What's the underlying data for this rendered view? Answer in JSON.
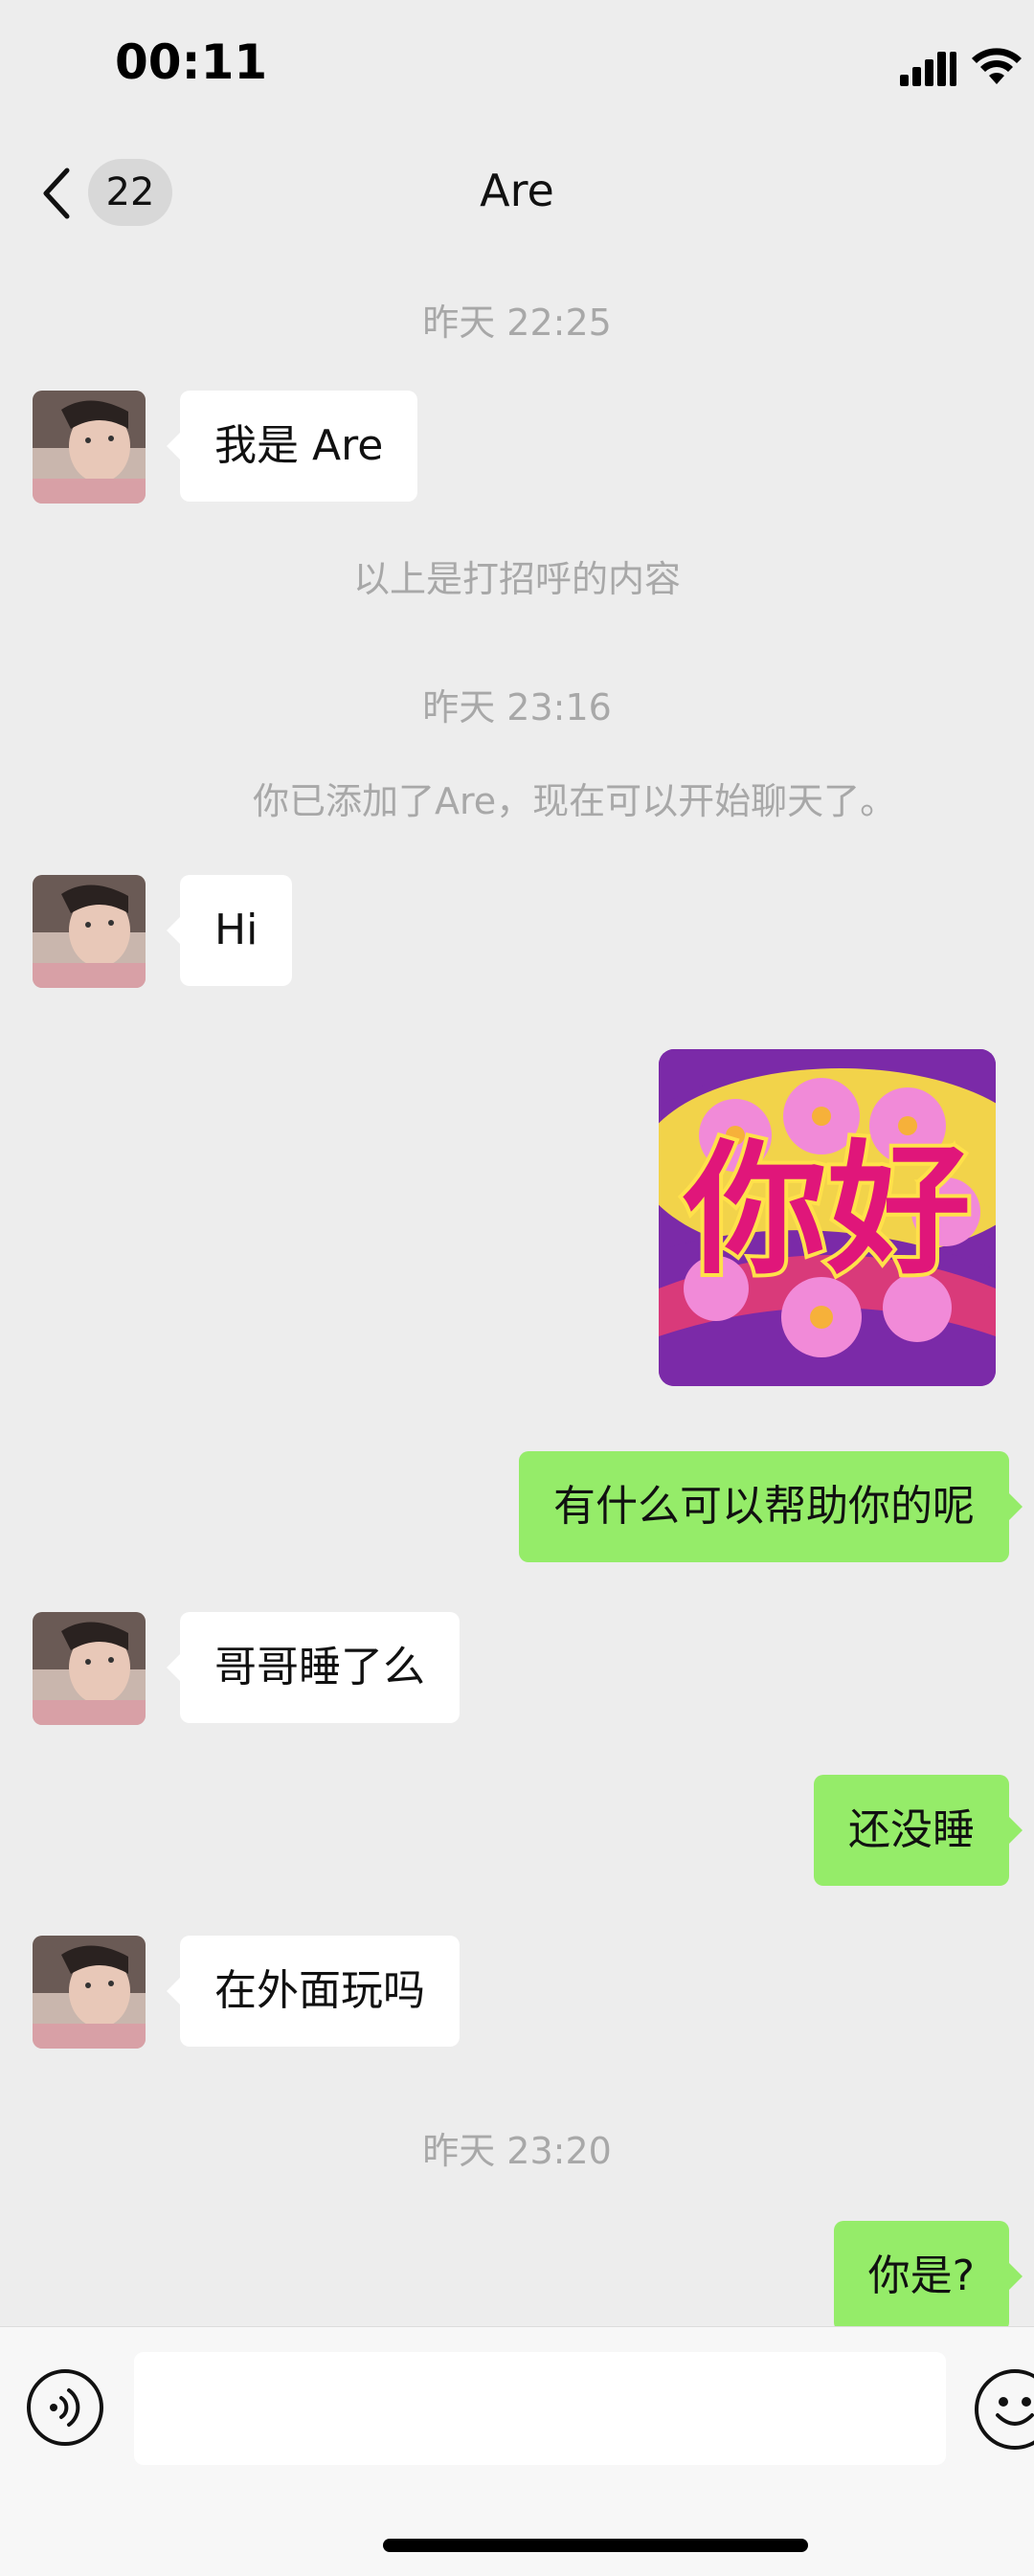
{
  "status_bar": {
    "time": "00:11"
  },
  "header": {
    "unread_count": "22",
    "title": "Are"
  },
  "messages": {
    "ts1": "昨天 22:25",
    "m1": "我是 Are",
    "sys1": "以上是打招呼的内容",
    "ts2": "昨天 23:16",
    "sys2": "你已添加了Are，现在可以开始聊天了。",
    "m2": "Hi",
    "sticker_text": "你好",
    "m3": "有什么可以帮助你的呢",
    "m4": "哥哥睡了么",
    "m5": "还没睡",
    "m6": "在外面玩吗",
    "ts3": "昨天 23:20",
    "m7": "你是?"
  },
  "input_bar": {
    "value": "",
    "placeholder": ""
  },
  "colors": {
    "background": "#ededed",
    "outgoing_bubble": "#95ec69",
    "incoming_bubble": "#ffffff",
    "timestamp_text": "#a8a8a8"
  },
  "icons": [
    "back-icon",
    "signal-icon",
    "wifi-icon",
    "voice-icon",
    "emoji-icon"
  ]
}
